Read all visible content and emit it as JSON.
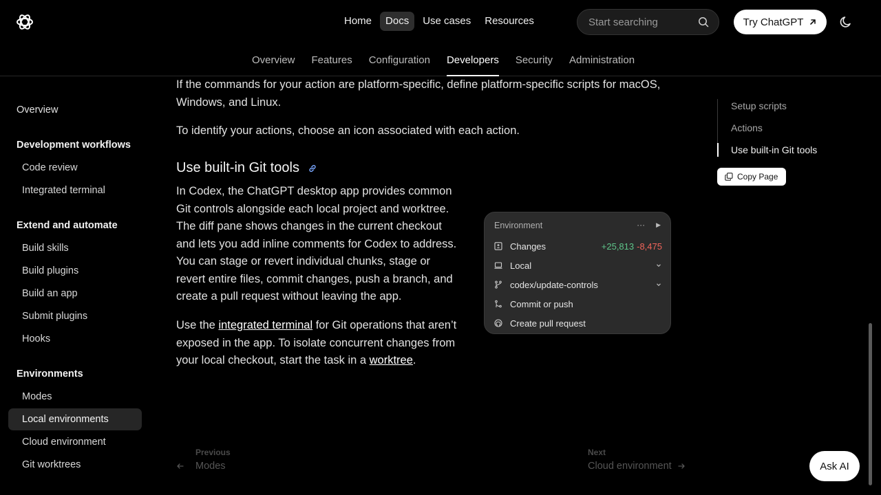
{
  "header": {
    "nav": [
      {
        "label": "Home",
        "active": false
      },
      {
        "label": "Docs",
        "active": true
      },
      {
        "label": "Use cases",
        "active": false
      },
      {
        "label": "Resources",
        "active": false
      }
    ],
    "search_placeholder": "Start searching",
    "try_button": "Try ChatGPT",
    "subnav": [
      {
        "label": "Overview",
        "active": false
      },
      {
        "label": "Features",
        "active": false
      },
      {
        "label": "Configuration",
        "active": false
      },
      {
        "label": "Developers",
        "active": true
      },
      {
        "label": "Security",
        "active": false
      },
      {
        "label": "Administration",
        "active": false
      }
    ]
  },
  "sidebar": {
    "overview": "Overview",
    "sections": [
      {
        "heading": "Development workflows",
        "items": [
          "Code review",
          "Integrated terminal"
        ]
      },
      {
        "heading": "Extend and automate",
        "items": [
          "Build skills",
          "Build plugins",
          "Build an app",
          "Submit plugins",
          "Hooks"
        ]
      },
      {
        "heading": "Environments",
        "items": [
          "Modes",
          "Local environments",
          "Cloud environment",
          "Git worktrees"
        ]
      }
    ],
    "active_item": "Local environments"
  },
  "content": {
    "p1": "If the commands for your action are platform-specific, define platform-specific scripts for macOS, Windows, and Linux.",
    "p2": "To identify your actions, choose an icon associated with each action.",
    "h2": "Use built-in Git tools",
    "p3": "In Codex, the ChatGPT desktop app provides common Git controls alongside each local project and worktree. The diff pane shows changes in the current checkout and lets you add inline comments for Codex to address. You can stage or revert individual chunks, stage or revert entire files, commit changes, push a branch, and create a pull request without leaving the app.",
    "p4_pre": "Use the ",
    "p4_link1": "integrated terminal",
    "p4_mid": " for Git operations that aren’t exposed in the app. To isolate concurrent changes from your local checkout, start the task in a ",
    "p4_link2": "worktree",
    "p4_post": "."
  },
  "git_panel": {
    "title": "Environment",
    "more": "···",
    "play": "▶",
    "changes_label": "Changes",
    "additions": "+25,813",
    "deletions": "-8,475",
    "local_label": "Local",
    "branch_label": "codex/update-controls",
    "commit_label": "Commit or push",
    "pr_label": "Create pull request"
  },
  "toc": {
    "items": [
      "Setup scripts",
      "Actions",
      "Use built-in Git tools"
    ],
    "active": "Use built-in Git tools",
    "copy_button": "Copy Page"
  },
  "pager": {
    "prev_caption": "Previous",
    "prev_title": "Modes",
    "next_caption": "Next",
    "next_title": "Cloud environment"
  },
  "ask_ai": "Ask AI"
}
